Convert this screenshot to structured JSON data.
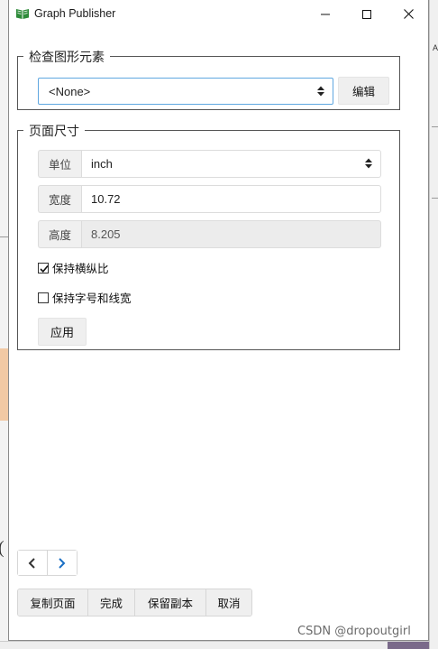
{
  "window": {
    "title": "Graph Publisher"
  },
  "inspect_group": {
    "legend": "检查图形元素",
    "element_select_value": "<None>",
    "edit_label": "编辑"
  },
  "page_size_group": {
    "legend": "页面尺寸",
    "unit": {
      "label": "单位",
      "value": "inch"
    },
    "width": {
      "label": "宽度",
      "value": "10.72"
    },
    "height": {
      "label": "高度",
      "value": "8.205"
    },
    "keep_aspect": {
      "label": "保持横纵比",
      "checked": true
    },
    "keep_font_line": {
      "label": "保持字号和线宽",
      "checked": false
    },
    "apply_label": "应用"
  },
  "actions": {
    "copy_page": "复制页面",
    "done": "完成",
    "keep_copy": "保留副本",
    "cancel": "取消"
  },
  "watermark": "CSDN @dropoutgirl",
  "colors": {
    "select_border": "#5fa7e0",
    "nav_next": "#1a6fc4",
    "icon_green": "#2e8b3a"
  }
}
